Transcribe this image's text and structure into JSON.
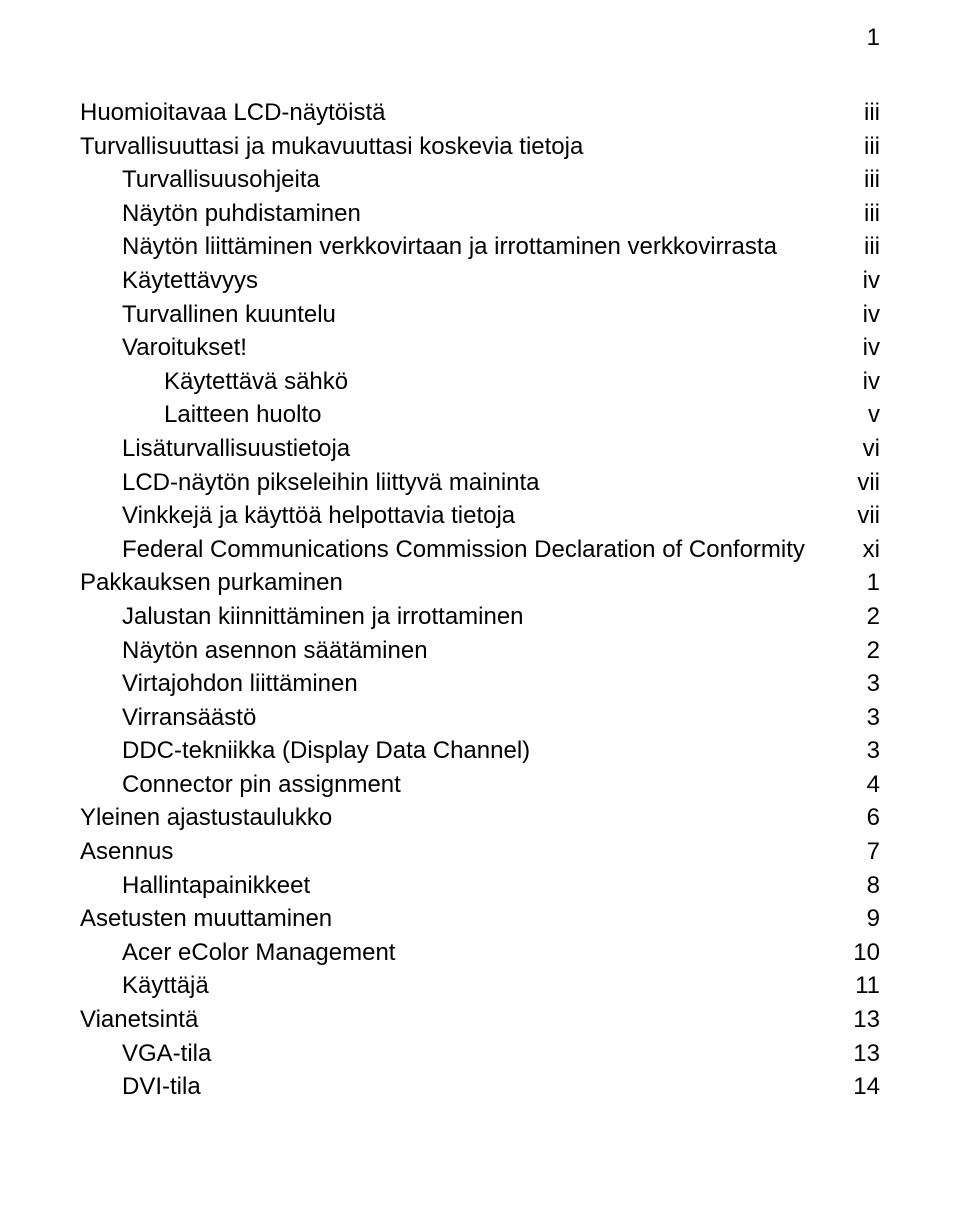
{
  "page_number": "1",
  "toc": [
    {
      "level": 0,
      "label": "Huomioitavaa LCD-näytöistä",
      "page": "iii"
    },
    {
      "level": 0,
      "label": "Turvallisuuttasi ja mukavuuttasi koskevia tietoja",
      "page": "iii"
    },
    {
      "level": 1,
      "label": "Turvallisuusohjeita",
      "page": "iii"
    },
    {
      "level": 1,
      "label": "Näytön puhdistaminen",
      "page": "iii"
    },
    {
      "level": 1,
      "label": "Näytön liittäminen verkkovirtaan ja irrottaminen verkkovirrasta",
      "page": "iii"
    },
    {
      "level": 1,
      "label": "Käytettävyys",
      "page": "iv"
    },
    {
      "level": 1,
      "label": "Turvallinen kuuntelu",
      "page": "iv"
    },
    {
      "level": 1,
      "label": "Varoitukset!",
      "page": "iv"
    },
    {
      "level": 2,
      "label": "Käytettävä sähkö",
      "page": "iv"
    },
    {
      "level": 2,
      "label": "Laitteen huolto",
      "page": "v"
    },
    {
      "level": 1,
      "label": "Lisäturvallisuustietoja",
      "page": "vi"
    },
    {
      "level": 1,
      "label": "LCD-näytön pikseleihin liittyvä maininta",
      "page": "vii"
    },
    {
      "level": 1,
      "label": "Vinkkejä ja käyttöä helpottavia tietoja",
      "page": "vii"
    },
    {
      "level": 1,
      "label": "Federal Communications Commission Declaration of Conformity",
      "page": "xi"
    },
    {
      "level": 0,
      "label": "Pakkauksen purkaminen",
      "page": "1"
    },
    {
      "level": 1,
      "label": "Jalustan kiinnittäminen ja irrottaminen",
      "page": "2"
    },
    {
      "level": 1,
      "label": "Näytön asennon säätäminen",
      "page": "2"
    },
    {
      "level": 1,
      "label": "Virtajohdon liittäminen",
      "page": "3"
    },
    {
      "level": 1,
      "label": "Virransäästö",
      "page": "3"
    },
    {
      "level": 1,
      "label": "DDC-tekniikka (Display Data Channel)",
      "page": "3"
    },
    {
      "level": 1,
      "label": "Connector pin assignment",
      "page": "4"
    },
    {
      "level": 0,
      "label": "Yleinen ajastustaulukko",
      "page": "6"
    },
    {
      "level": 0,
      "label": "Asennus",
      "page": "7"
    },
    {
      "level": 1,
      "label": "Hallintapainikkeet",
      "page": "8"
    },
    {
      "level": 0,
      "label": "Asetusten muuttaminen",
      "page": "9"
    },
    {
      "level": 1,
      "label": "Acer eColor Management",
      "page": "10"
    },
    {
      "level": 1,
      "label": "Käyttäjä",
      "page": "11"
    },
    {
      "level": 0,
      "label": "Vianetsintä",
      "page": "13"
    },
    {
      "level": 1,
      "label": "VGA-tila",
      "page": "13"
    },
    {
      "level": 1,
      "label": "DVI-tila",
      "page": "14"
    }
  ]
}
